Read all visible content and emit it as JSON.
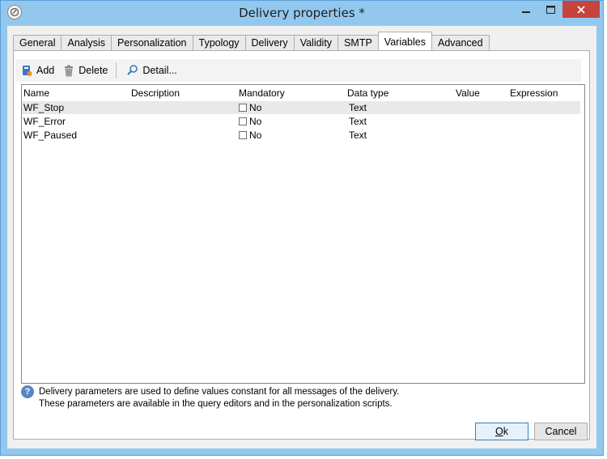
{
  "window": {
    "title": "Delivery properties *"
  },
  "tabs": [
    "General",
    "Analysis",
    "Personalization",
    "Typology",
    "Delivery",
    "Validity",
    "SMTP",
    "Variables",
    "Advanced"
  ],
  "active_tab": "Variables",
  "toolbar": {
    "add": "Add",
    "delete": "Delete",
    "detail": "Detail..."
  },
  "table": {
    "columns": [
      "Name",
      "Description",
      "Mandatory",
      "Data type",
      "Value",
      "Expression"
    ],
    "rows": [
      {
        "name": "WF_Stop",
        "description": "",
        "mandatory": "No",
        "data_type": "Text",
        "value": "",
        "expression": ""
      },
      {
        "name": "WF_Error",
        "description": "",
        "mandatory": "No",
        "data_type": "Text",
        "value": "",
        "expression": ""
      },
      {
        "name": "WF_Paused",
        "description": "",
        "mandatory": "No",
        "data_type": "Text",
        "value": "",
        "expression": ""
      }
    ]
  },
  "info": {
    "line1": "Delivery parameters are used to define values constant for all messages of the delivery.",
    "line2": "These parameters are available in the query editors and in the personalization scripts."
  },
  "buttons": {
    "ok_prefix": "O",
    "ok_rest": "k",
    "cancel": "Cancel"
  }
}
